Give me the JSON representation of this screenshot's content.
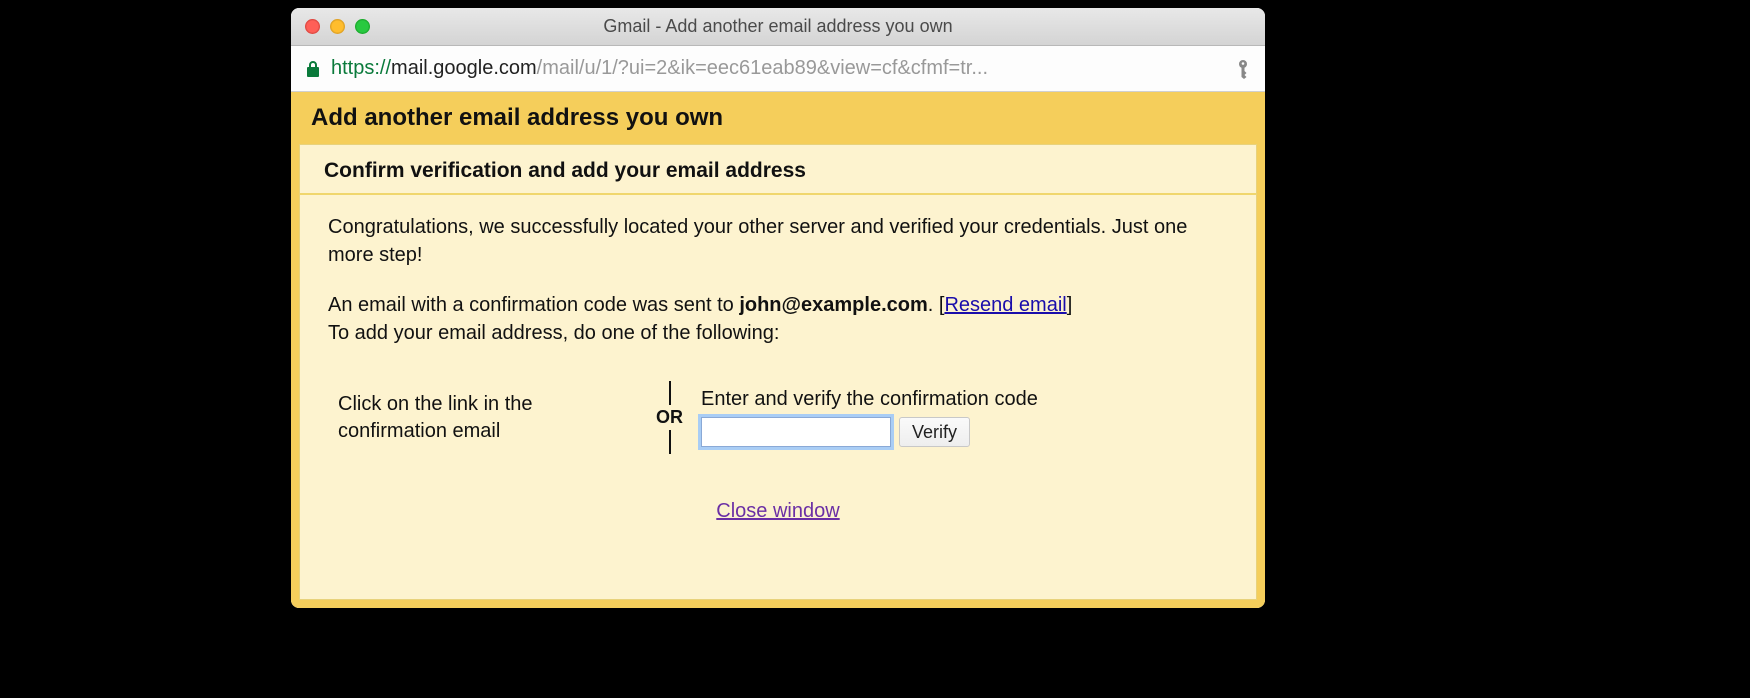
{
  "window": {
    "title": "Gmail - Add another email address you own"
  },
  "address": {
    "scheme": "https",
    "host": "mail.google.com",
    "path": "/mail/u/1/?ui=2&ik=eec61eab89&view=cf&cfmf=tr",
    "ellipsis": "..."
  },
  "banner": {
    "title": "Add another email address you own"
  },
  "panel": {
    "subheader": "Confirm verification and add your email address",
    "congrats": "Congratulations, we successfully located your other server and verified your credentials. Just one more step!",
    "sent_prefix": "An email with a confirmation code was sent to ",
    "sent_email": "john@example.com",
    "sent_period": ". ",
    "resend_open": "[",
    "resend_label": "Resend email",
    "resend_close": "]",
    "instruction": "To add your email address, do one of the following:",
    "option_left": "Click on the link in the confirmation email",
    "or_label": "OR",
    "option_right_label": "Enter and verify the confirmation code",
    "code_value": "",
    "verify_label": "Verify",
    "close_label": "Close window"
  }
}
